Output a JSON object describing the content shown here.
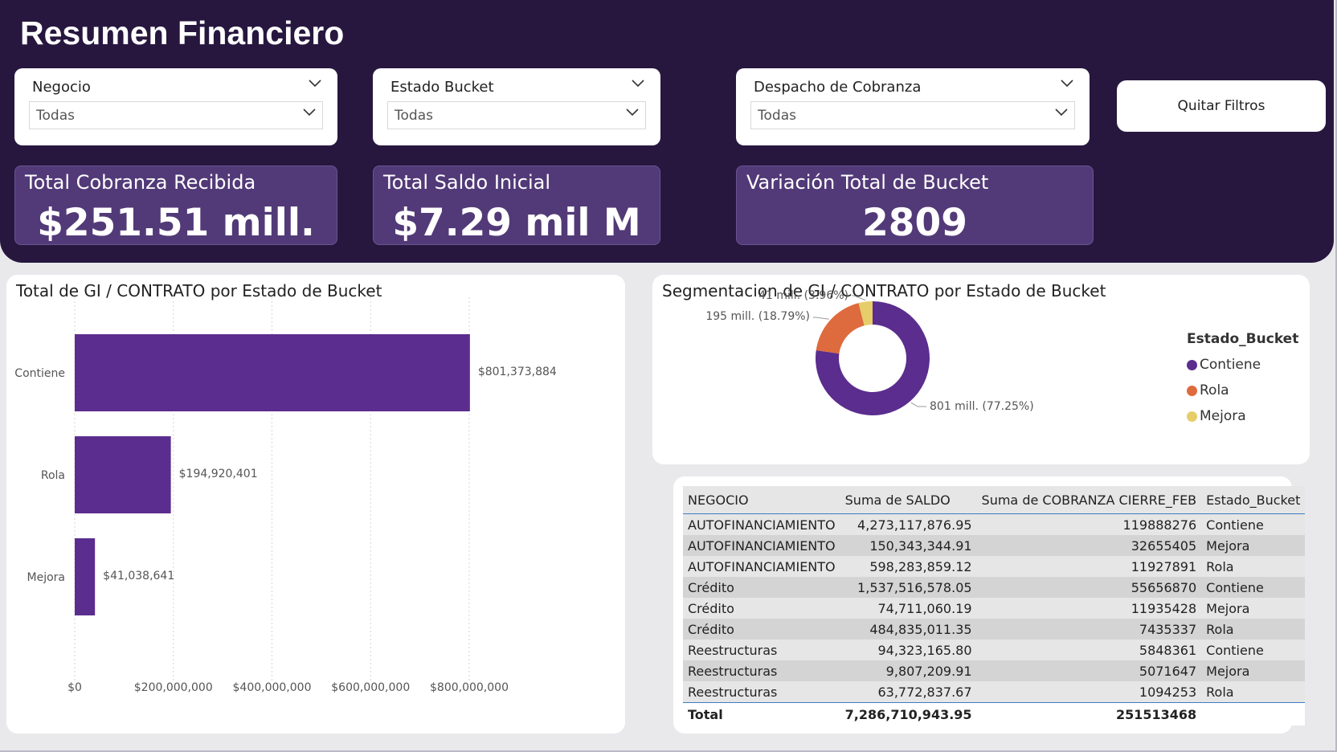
{
  "page_title": "Resumen Financiero",
  "slicers": [
    {
      "label": "Negocio",
      "value": "Todas"
    },
    {
      "label": "Estado Bucket",
      "value": "Todas"
    },
    {
      "label": "Despacho de Cobranza",
      "value": "Todas"
    }
  ],
  "clear_filters_label": "Quitar Filtros",
  "kpis": [
    {
      "label": "Total Cobranza Recibida",
      "value": "$251.51 mill."
    },
    {
      "label": "Total Saldo Inicial",
      "value": "$7.29 mil M"
    },
    {
      "label": "Variación Total de Bucket",
      "value": "2809"
    }
  ],
  "bar_chart": {
    "title": "Total de GI / CONTRATO por Estado de Bucket",
    "chart_data": {
      "type": "bar",
      "orientation": "horizontal",
      "categories": [
        "Contiene",
        "Rola",
        "Mejora"
      ],
      "values": [
        801373884,
        194920401,
        41038641
      ],
      "data_labels": [
        "$801,373,884",
        "$194,920,401",
        "$41,038,641"
      ],
      "x_ticks": [
        0,
        200000000,
        400000000,
        600000000,
        800000000
      ],
      "x_tick_labels": [
        "$0",
        "$200,000,000",
        "$400,000,000",
        "$600,000,000",
        "$800,000,000"
      ],
      "xlim": [
        0,
        1000000000
      ],
      "color": "#5b2d8e",
      "grid": true
    }
  },
  "donut_chart": {
    "title": "Segmentacion de GI / CONTRATO por Estado de Bucket",
    "legend_title": "Estado_Bucket",
    "chart_data": {
      "type": "pie",
      "variant": "donut",
      "legend_position": "right",
      "categories": [
        "Contiene",
        "Rola",
        "Mejora"
      ],
      "values": [
        801373884,
        194920401,
        41038641
      ],
      "colors": [
        "#5b2d8e",
        "#dd6b3d",
        "#e6cd6a"
      ],
      "data_labels": [
        "801 mill. (77.25%)",
        "195 mill. (18.79%)",
        "41 mill. (3.96%)"
      ]
    }
  },
  "table": {
    "headers": [
      "NEGOCIO",
      "Suma de SALDO",
      "Suma de COBRANZA CIERRE_FEB",
      "Estado_Bucket"
    ],
    "rows": [
      [
        "AUTOFINANCIAMIENTO",
        "4,273,117,876.95",
        "119888276",
        "Contiene"
      ],
      [
        "AUTOFINANCIAMIENTO",
        "150,343,344.91",
        "32655405",
        "Mejora"
      ],
      [
        "AUTOFINANCIAMIENTO",
        "598,283,859.12",
        "11927891",
        "Rola"
      ],
      [
        "Crédito",
        "1,537,516,578.05",
        "55656870",
        "Contiene"
      ],
      [
        "Crédito",
        "74,711,060.19",
        "11935428",
        "Mejora"
      ],
      [
        "Crédito",
        "484,835,011.35",
        "7435337",
        "Rola"
      ],
      [
        "Reestructuras",
        "94,323,165.80",
        "5848361",
        "Contiene"
      ],
      [
        "Reestructuras",
        "9,807,209.91",
        "5071647",
        "Mejora"
      ],
      [
        "Reestructuras",
        "63,772,837.67",
        "1094253",
        "Rola"
      ]
    ],
    "total": [
      "Total",
      "7,286,710,943.95",
      "251513468",
      ""
    ]
  }
}
